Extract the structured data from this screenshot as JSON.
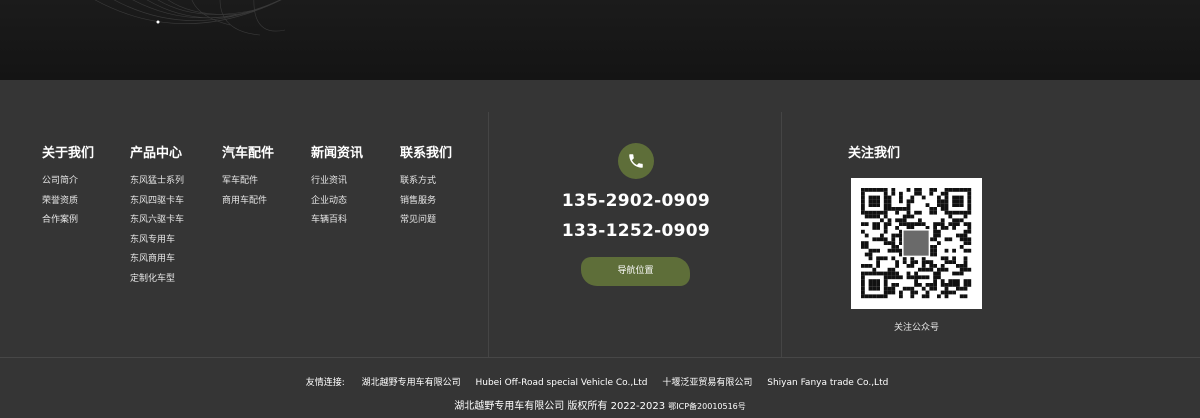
{
  "nav": {
    "columns": [
      {
        "title": "关于我们",
        "links": [
          "公司简介",
          "荣誉资质",
          "合作案例"
        ]
      },
      {
        "title": "产品中心",
        "links": [
          "东风猛士系列",
          "东风四驱卡车",
          "东风六驱卡车",
          "东风专用车",
          "东风商用车",
          "定制化车型"
        ]
      },
      {
        "title": "汽车配件",
        "links": [
          "军车配件",
          "商用车配件"
        ]
      },
      {
        "title": "新闻资讯",
        "links": [
          "行业资讯",
          "企业动态",
          "车辆百科"
        ]
      },
      {
        "title": "联系我们",
        "links": [
          "联系方式",
          "销售服务",
          "常见问题"
        ]
      }
    ]
  },
  "contact": {
    "icon": "phone-icon",
    "phone1": "135-2902-0909",
    "phone2": "133-1252-0909",
    "nav_button": "导航位置"
  },
  "follow": {
    "title": "关注我们",
    "qr_caption": "关注公众号"
  },
  "friend_links": {
    "label": "友情连接:",
    "items": [
      "湖北越野专用车有限公司",
      "Hubei Off-Road special Vehicle Co.,Ltd",
      "十堰泛亚贸易有限公司",
      "Shiyan Fanya trade Co.,Ltd"
    ]
  },
  "copyright": {
    "text": "湖北越野专用车有限公司 版权所有 2022-2023",
    "icp": "鄂ICP备20010516号"
  },
  "colors": {
    "accent": "#5e6e39",
    "background": "#353535",
    "top_band": "#151515"
  }
}
